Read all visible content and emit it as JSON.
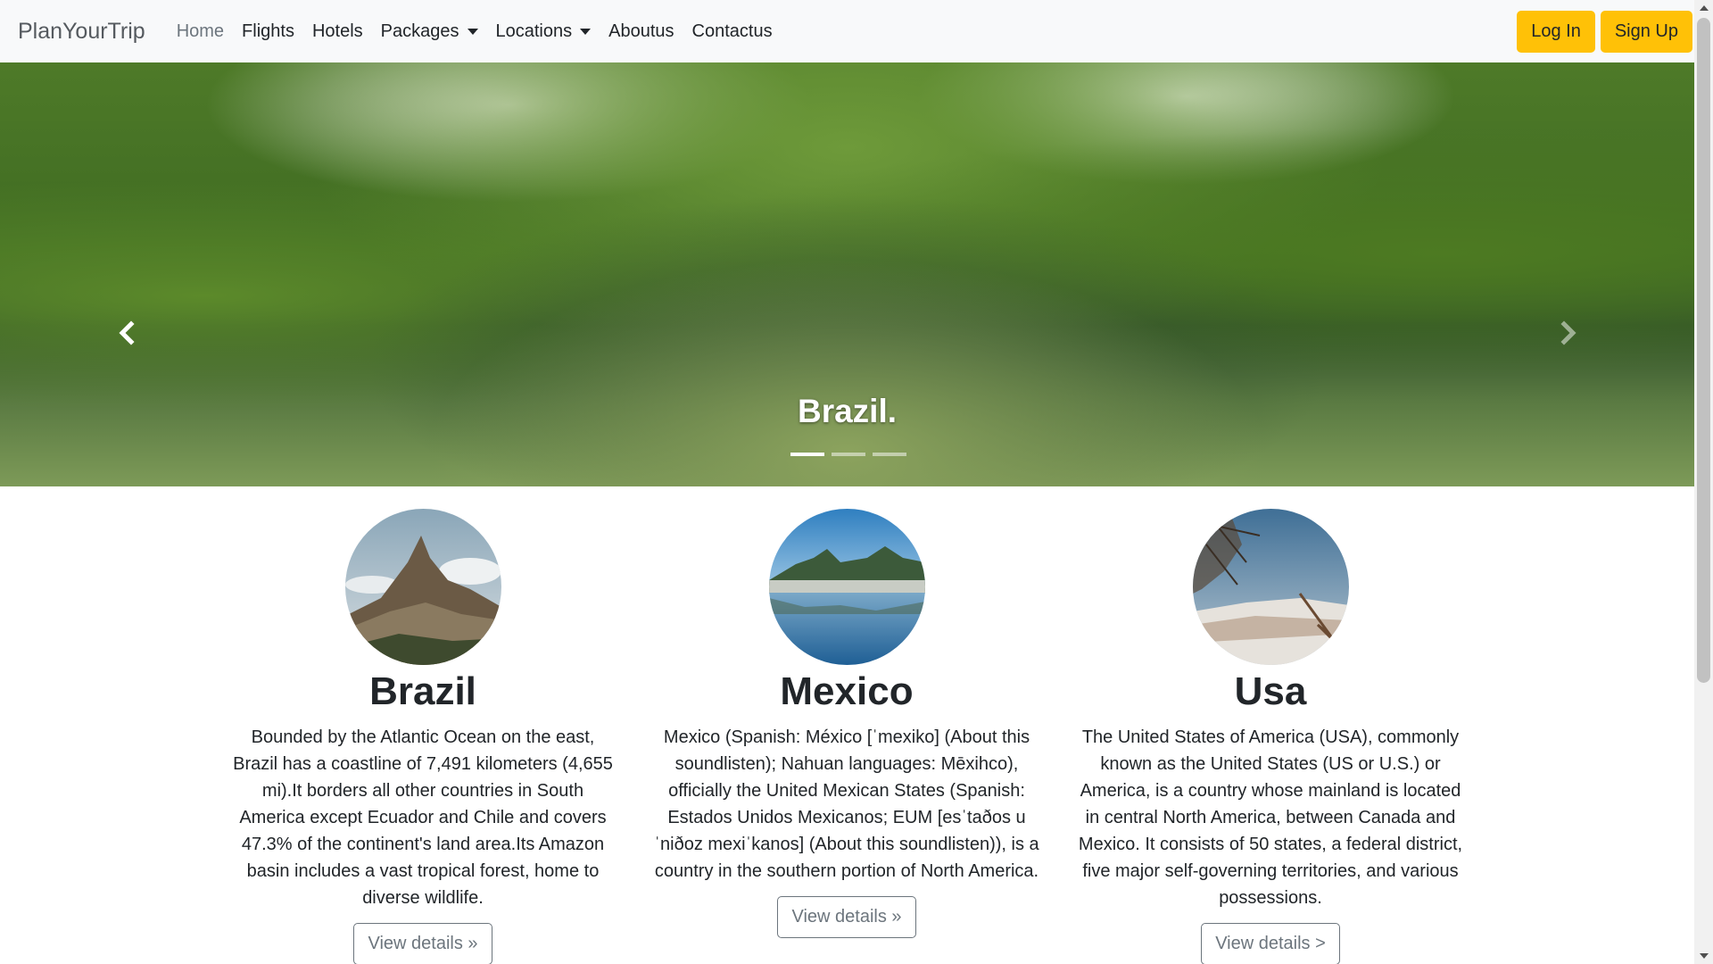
{
  "navbar": {
    "brand": "PlanYourTrip",
    "links": [
      {
        "label": "Home",
        "active": true,
        "dropdown": false
      },
      {
        "label": "Flights",
        "active": false,
        "dropdown": false
      },
      {
        "label": "Hotels",
        "active": false,
        "dropdown": false
      },
      {
        "label": "Packages",
        "active": false,
        "dropdown": true
      },
      {
        "label": "Locations",
        "active": false,
        "dropdown": true
      },
      {
        "label": "Aboutus",
        "active": false,
        "dropdown": false
      },
      {
        "label": "Contactus",
        "active": false,
        "dropdown": false
      }
    ],
    "login_label": "Log In",
    "signup_label": "Sign Up"
  },
  "carousel": {
    "caption": "Brazil.",
    "indicator_count": 3,
    "active_index": 0
  },
  "cards": [
    {
      "title": "Brazil",
      "text": "Bounded by the Atlantic Ocean on the east, Brazil has a coastline of 7,491 kilometers (4,655 mi).It borders all other countries in South America except Ecuador and Chile and covers 47.3% of the continent's land area.Its Amazon basin includes a vast tropical forest, home to diverse wildlife.",
      "button": "View details »"
    },
    {
      "title": "Mexico",
      "text": "Mexico (Spanish: México [ˈmexiko] (About this soundlisten); Nahuan languages: Mēxihco), officially the United Mexican States (Spanish: Estados Unidos Mexicanos; EUM [esˈtaðos u ˈniðoz mexiˈkanos] (About this soundlisten)), is a country in the southern portion of North America.",
      "button": "View details »"
    },
    {
      "title": "Usa",
      "text": "The United States of America (USA), commonly known as the United States (US or U.S.) or America, is a country whose mainland is located in central North America, between Canada and Mexico. It consists of 50 states, a federal district, five major self-governing territories, and various possessions.",
      "button": "View details >"
    }
  ],
  "colors": {
    "navbar_bg": "#f8f9fa",
    "accent_warning": "#ffc107",
    "text": "#212529",
    "muted": "#6c757d"
  }
}
